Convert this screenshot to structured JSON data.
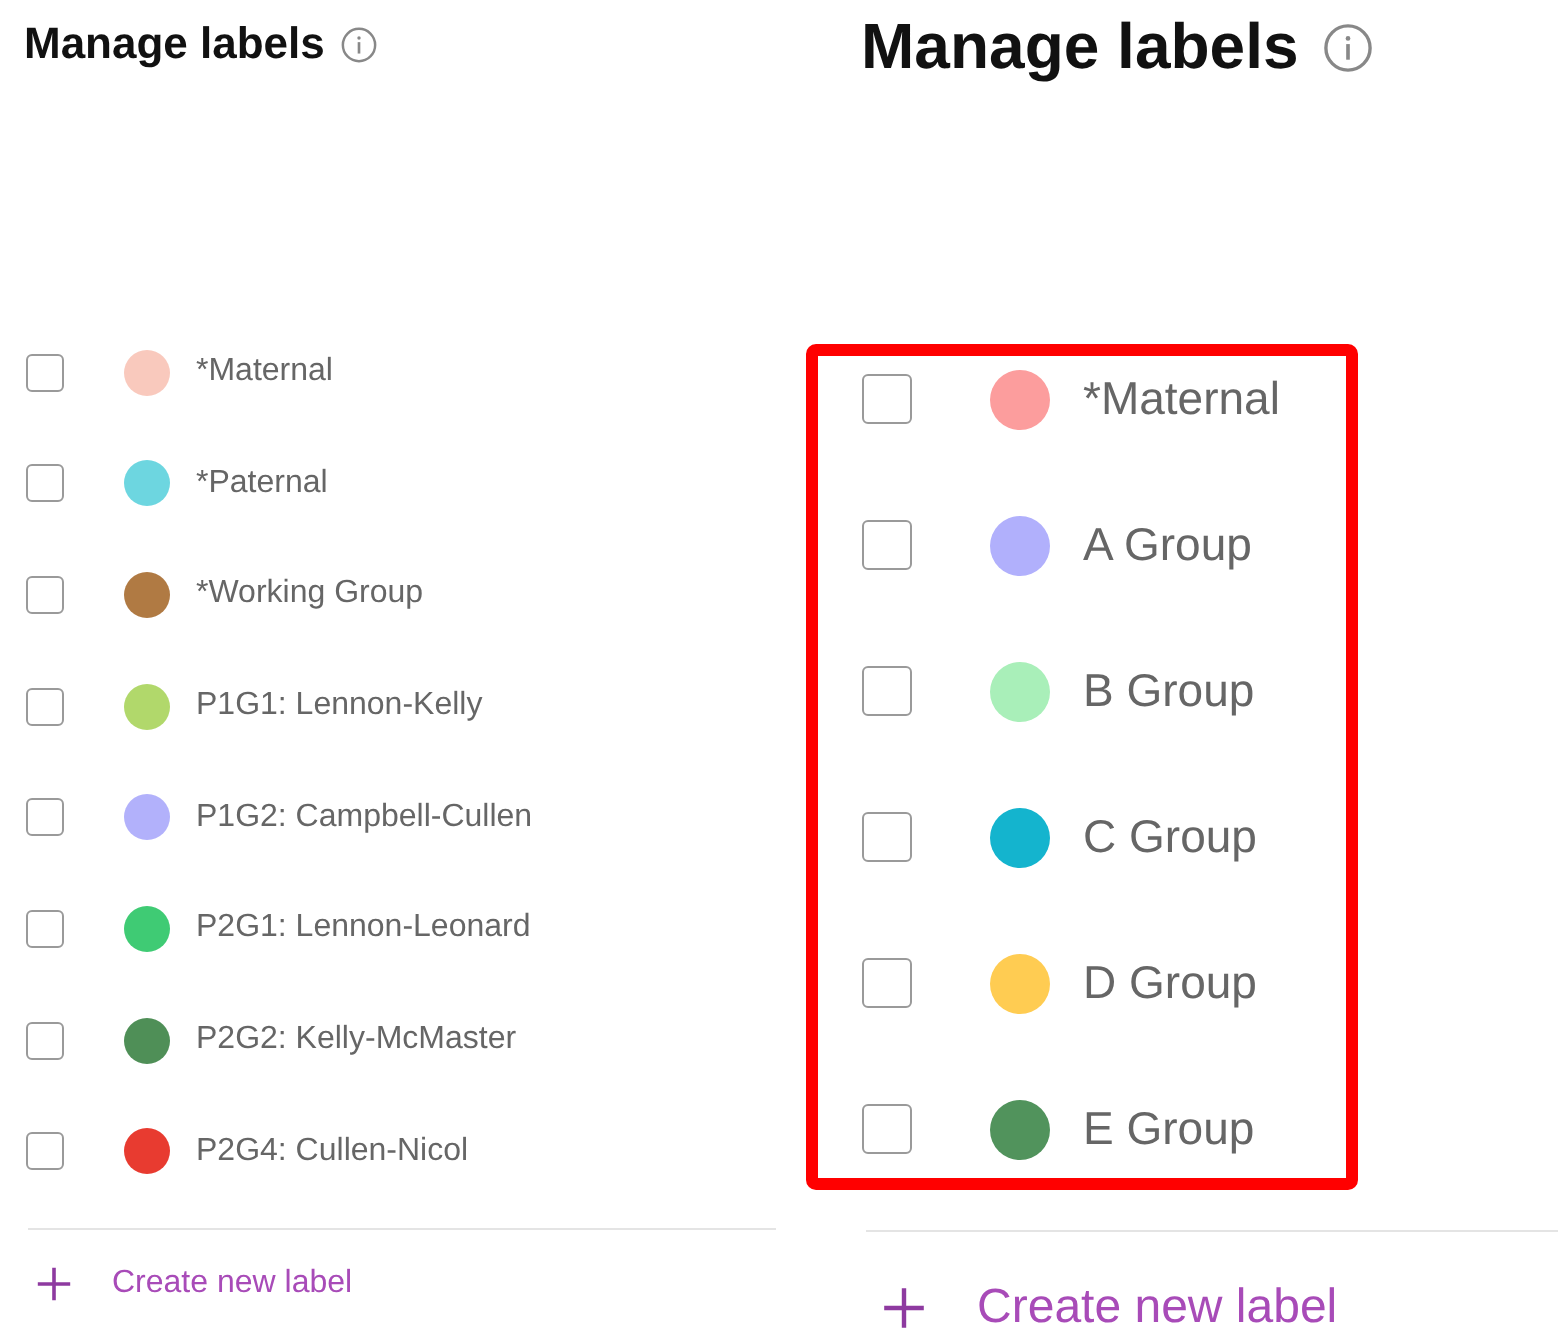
{
  "panels": [
    {
      "title": "Manage labels",
      "kind": "small",
      "labels": [
        {
          "name": "*Maternal",
          "color": "#f9c9bd",
          "checked": false
        },
        {
          "name": "*Paternal",
          "color": "#6dd6e0",
          "checked": false
        },
        {
          "name": "*Working Group",
          "color": "#b07a43",
          "checked": false
        },
        {
          "name": "P1G1: Lennon-Kelly",
          "color": "#b1d86b",
          "checked": false
        },
        {
          "name": "P1G2: Campbell-Cullen",
          "color": "#b2b1fb",
          "checked": false
        },
        {
          "name": "P2G1: Lennon-Leonard",
          "color": "#3fcb74",
          "checked": false
        },
        {
          "name": "P2G2: Kelly-McMaster",
          "color": "#4f8f57",
          "checked": false
        },
        {
          "name": "P2G4: Cullen-Nicol",
          "color": "#e83b30",
          "checked": false
        }
      ],
      "create_label": "Create new label"
    },
    {
      "title": "Manage labels",
      "kind": "large",
      "highlighted": true,
      "labels": [
        {
          "name": "*Maternal",
          "color": "#fc9d9d",
          "checked": false
        },
        {
          "name": "A Group",
          "color": "#b1b0fc",
          "checked": false
        },
        {
          "name": "B Group",
          "color": "#a9efb9",
          "checked": false
        },
        {
          "name": "C Group",
          "color": "#14b4ce",
          "checked": false
        },
        {
          "name": "D Group",
          "color": "#ffcc52",
          "checked": false
        },
        {
          "name": "E Group",
          "color": "#51935c",
          "checked": false
        }
      ],
      "create_label": "Create new label"
    }
  ]
}
